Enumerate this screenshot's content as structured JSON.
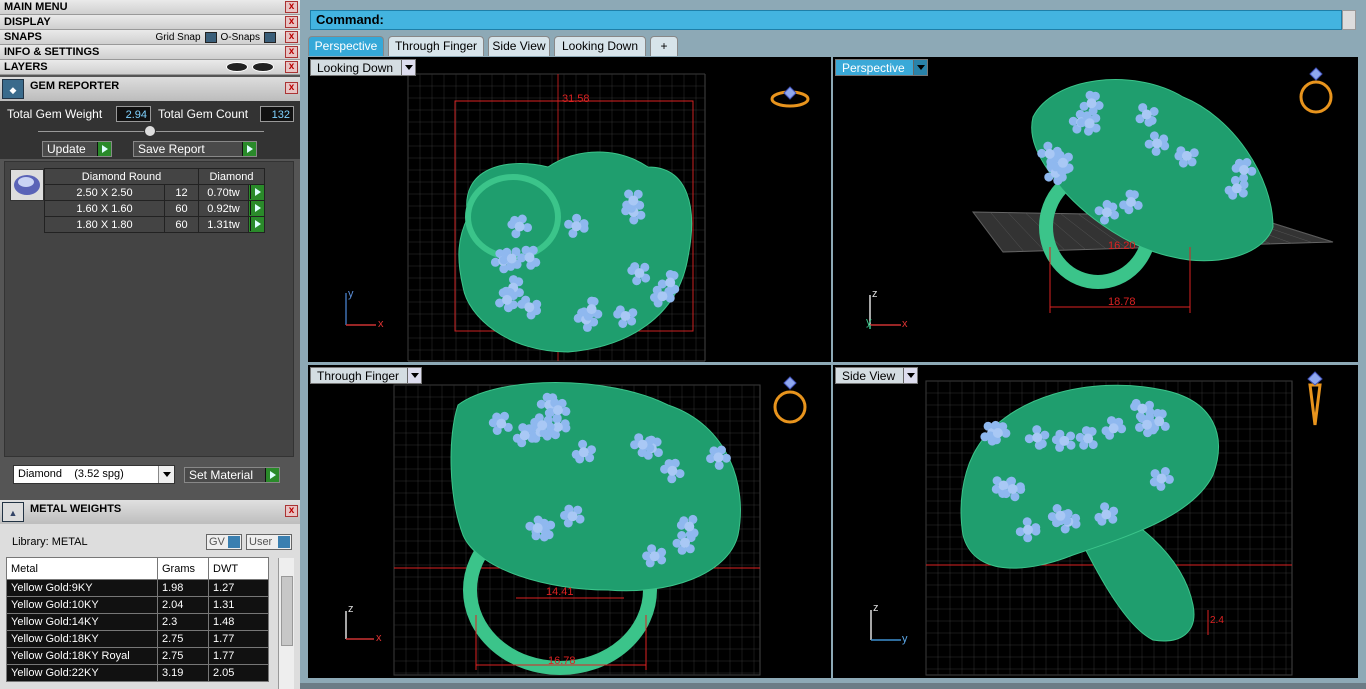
{
  "menus": {
    "main_menu": "MAIN MENU",
    "display": "DISPLAY",
    "snaps": "SNAPS",
    "grid_snap": "Grid Snap",
    "o_snaps": "O-Snaps",
    "info_settings": "INFO & SETTINGS",
    "layers": "LAYERS",
    "close": "x"
  },
  "gem_reporter": {
    "title": "GEM REPORTER",
    "total_weight_label": "Total Gem Weight",
    "total_weight_value": "2.94",
    "total_count_label": "Total Gem Count",
    "total_count_value": "132",
    "update_label": "Update",
    "save_report_label": "Save Report",
    "table_headers": [
      "Diamond Round",
      "Diamond"
    ],
    "rows": [
      {
        "size": "2.50 X 2.50",
        "count": "12",
        "weight": "0.70tw"
      },
      {
        "size": "1.60 X 1.60",
        "count": "60",
        "weight": "0.92tw"
      },
      {
        "size": "1.80 X 1.80",
        "count": "60",
        "weight": "1.31tw"
      }
    ],
    "material_select": "Diamond    (3.52 spg)",
    "set_material_label": "Set Material"
  },
  "metal_weights": {
    "title": "METAL WEIGHTS",
    "library_label": "Library: METAL",
    "gv_label": "GV",
    "user_label": "User",
    "headers": [
      "Metal",
      "Grams",
      "DWT"
    ],
    "rows": [
      {
        "metal": "Yellow Gold:9KY",
        "grams": "1.98",
        "dwt": "1.27"
      },
      {
        "metal": "Yellow Gold:10KY",
        "grams": "2.04",
        "dwt": "1.31"
      },
      {
        "metal": "Yellow Gold:14KY",
        "grams": "2.3",
        "dwt": "1.48"
      },
      {
        "metal": "Yellow Gold:18KY",
        "grams": "2.75",
        "dwt": "1.77"
      },
      {
        "metal": "Yellow Gold:18KY Royal",
        "grams": "2.75",
        "dwt": "1.77"
      },
      {
        "metal": "Yellow Gold:22KY",
        "grams": "3.19",
        "dwt": "2.05"
      }
    ]
  },
  "command": {
    "label": "Command:"
  },
  "tabs": [
    {
      "label": "Perspective",
      "active": true
    },
    {
      "label": "Through Finger",
      "active": false
    },
    {
      "label": "Side View",
      "active": false
    },
    {
      "label": "Looking Down",
      "active": false
    },
    {
      "label": "+",
      "active": false
    }
  ],
  "viewports": [
    {
      "label": "Looking Down",
      "dimension": "31.58",
      "axes": [
        "y",
        "x"
      ]
    },
    {
      "label": "Perspective",
      "dimension_a": "16.20",
      "dimension_b": "18.78",
      "axes": [
        "z",
        "y",
        "x"
      ]
    },
    {
      "label": "Through Finger",
      "dimension_a": "14.41",
      "dimension_b": "16.78",
      "axes": [
        "z",
        "x"
      ]
    },
    {
      "label": "Side View",
      "dimension": "2.4",
      "axes": [
        "z",
        "y"
      ]
    }
  ],
  "colors": {
    "accent": "#3aa9d8",
    "model_green": "#1f9e6e",
    "gem_blue": "#8fb8ef",
    "dimension_red": "#d22"
  }
}
